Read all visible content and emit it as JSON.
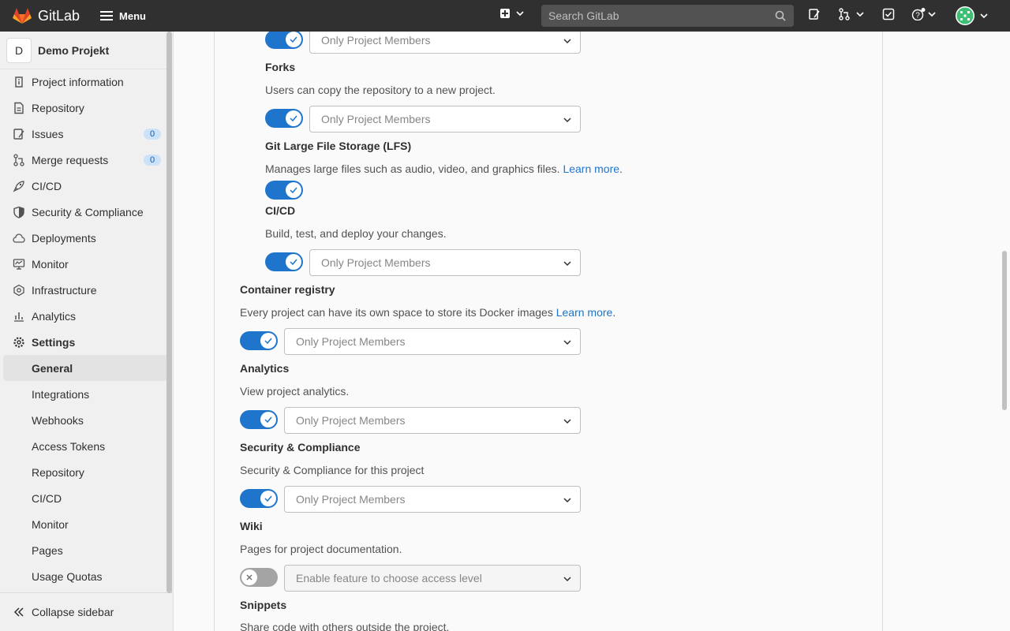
{
  "navbar": {
    "brand": "GitLab",
    "menu_label": "Menu",
    "search_placeholder": "Search GitLab"
  },
  "sidebar": {
    "project_initial": "D",
    "project_name": "Demo Projekt",
    "items": [
      {
        "label": "Project information",
        "icon": "info-icon"
      },
      {
        "label": "Repository",
        "icon": "doc-icon"
      },
      {
        "label": "Issues",
        "icon": "issues-icon",
        "badge": "0"
      },
      {
        "label": "Merge requests",
        "icon": "merge-request-icon",
        "badge": "0"
      },
      {
        "label": "CI/CD",
        "icon": "rocket-icon"
      },
      {
        "label": "Security & Compliance",
        "icon": "shield-icon"
      },
      {
        "label": "Deployments",
        "icon": "cloud-icon"
      },
      {
        "label": "Monitor",
        "icon": "monitor-icon"
      },
      {
        "label": "Infrastructure",
        "icon": "infrastructure-icon"
      },
      {
        "label": "Analytics",
        "icon": "chart-icon"
      },
      {
        "label": "Settings",
        "icon": "gear-icon"
      }
    ],
    "subitems": [
      "General",
      "Integrations",
      "Webhooks",
      "Access Tokens",
      "Repository",
      "CI/CD",
      "Monitor",
      "Pages",
      "Usage Quotas"
    ],
    "active_subitem": "General",
    "collapse_label": "Collapse sidebar"
  },
  "main": {
    "top_select": "Only Project Members",
    "sections": [
      {
        "title": "Forks",
        "desc": "Users can copy the repository to a new project.",
        "select": "Only Project Members",
        "enabled": true
      },
      {
        "title": "Git Large File Storage (LFS)",
        "desc": "Manages large files such as audio, video, and graphics files.",
        "link": "Learn more",
        "enabled": true
      },
      {
        "title": "CI/CD",
        "desc": "Build, test, and deploy your changes.",
        "select": "Only Project Members",
        "enabled": true
      },
      {
        "title": "Container registry",
        "desc": "Every project can have its own space to store its Docker images",
        "link": "Learn more",
        "select": "Only Project Members",
        "enabled": true
      },
      {
        "title": "Analytics",
        "desc": "View project analytics.",
        "select": "Only Project Members",
        "enabled": true
      },
      {
        "title": "Security & Compliance",
        "desc": "Security & Compliance for this project",
        "select": "Only Project Members",
        "enabled": true
      },
      {
        "title": "Wiki",
        "desc": "Pages for project documentation.",
        "select": "Enable feature to choose access level",
        "enabled": false
      },
      {
        "title": "Snippets",
        "desc": "Share code with others outside the project."
      }
    ]
  },
  "colors": {
    "navbar_bg": "#303030",
    "toggle_on": "#1f75cb",
    "toggle_off": "#a4a4a4",
    "link": "#1f75cb",
    "badge_bg": "#cbe2f9"
  }
}
